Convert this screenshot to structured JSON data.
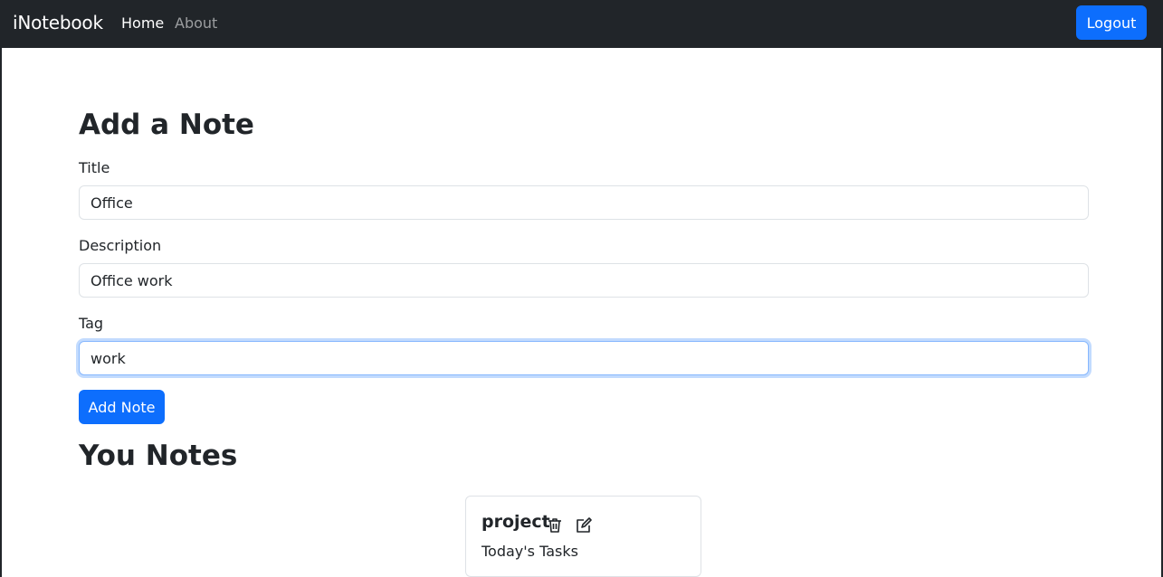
{
  "navbar": {
    "brand": "iNotebook",
    "links": [
      "Home",
      "About"
    ],
    "logout_label": "Logout"
  },
  "form": {
    "heading": "Add a Note",
    "title_label": "Title",
    "title_value": "Office",
    "description_label": "Description",
    "description_value": "Office work",
    "tag_label": "Tag",
    "tag_value": "work",
    "submit_label": "Add Note"
  },
  "notes": {
    "heading": "You Notes",
    "items": [
      {
        "title": "project",
        "description": "Today's Tasks"
      }
    ]
  },
  "icons": {
    "delete": "trash-icon",
    "edit": "edit-icon"
  },
  "colors": {
    "navbar_bg": "#212529",
    "primary": "#0d6efd"
  }
}
